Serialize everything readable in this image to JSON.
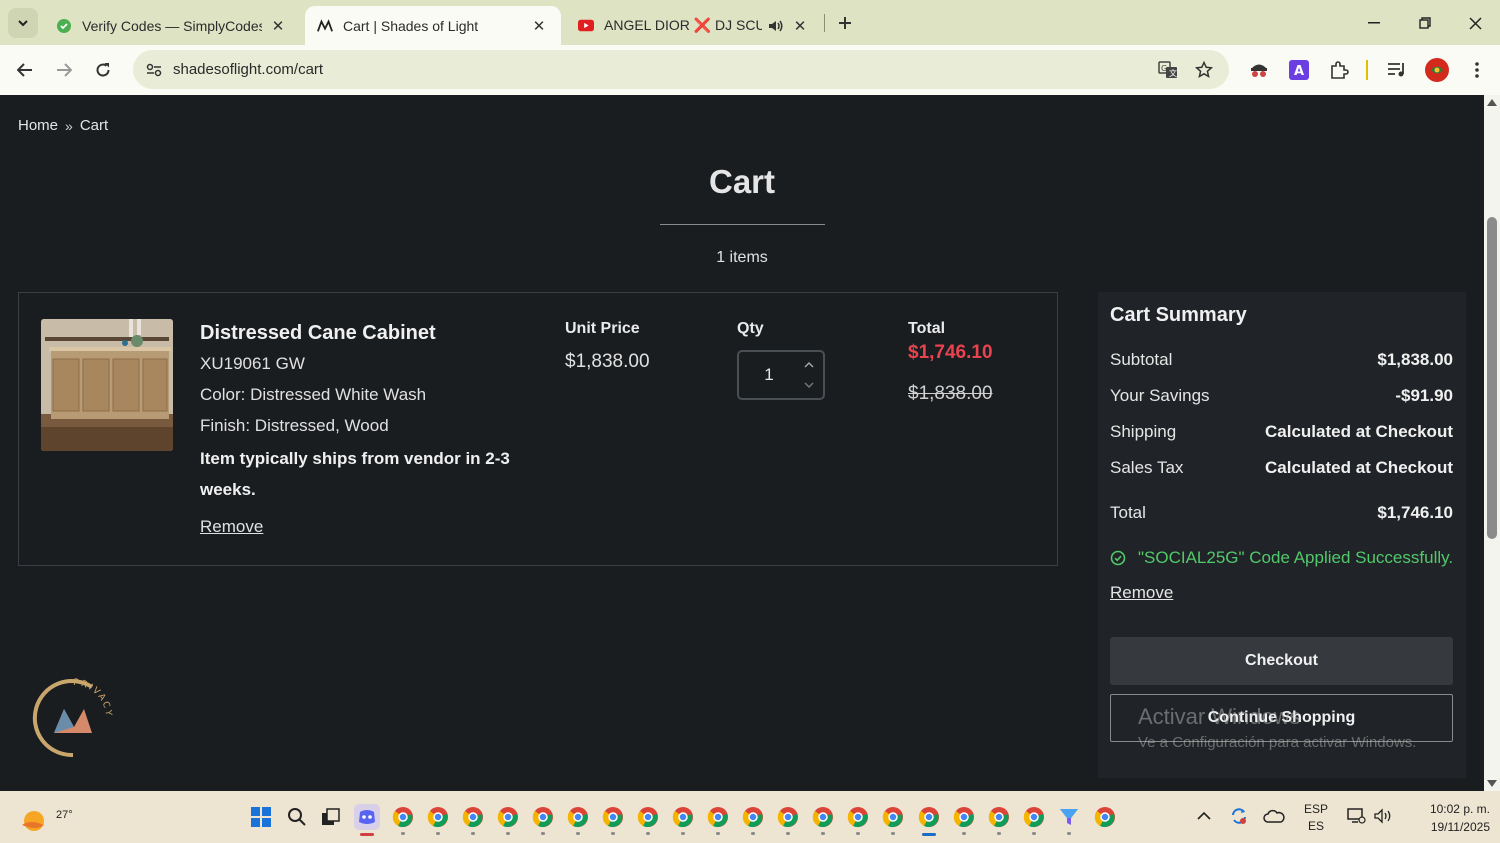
{
  "browser": {
    "tabs": [
      {
        "title": "Verify Codes — SimplyCodes",
        "close": "✕"
      },
      {
        "title": "Cart | Shades of Light",
        "close": "✕"
      },
      {
        "title": "ANGEL DIOR ❌ DJ SCUFF",
        "close": "✕"
      }
    ],
    "url": "shadesoflight.com/cart"
  },
  "page": {
    "breadcrumb": {
      "home": "Home",
      "separator": "»",
      "current": "Cart"
    },
    "title": "Cart",
    "items_count": "1 items",
    "item": {
      "name": "Distressed Cane Cabinet",
      "sku": "XU19061 GW",
      "color": "Color: Distressed White Wash",
      "finish": "Finish: Distressed, Wood",
      "shipping_note": "Item typically ships from vendor in 2-3 weeks.",
      "remove": "Remove",
      "unit_price_label": "Unit Price",
      "unit_price": "$1,838.00",
      "qty_label": "Qty",
      "qty": "1",
      "total_label": "Total",
      "total_discounted": "$1,746.10",
      "total_original": "$1,838.00"
    },
    "summary": {
      "title": "Cart Summary",
      "rows": [
        {
          "label": "Subtotal",
          "value": "$1,838.00"
        },
        {
          "label": "Your Savings",
          "value": "-$91.90"
        },
        {
          "label": "Shipping",
          "value": "Calculated at Checkout"
        },
        {
          "label": "Sales Tax",
          "value": "Calculated at Checkout"
        },
        {
          "label": "Total",
          "value": "$1,746.10"
        }
      ],
      "coupon_message": "\"SOCIAL25G\" Code Applied Successfully.",
      "remove": "Remove",
      "checkout": "Checkout",
      "continue": "Continue Shopping"
    },
    "privacy_badge": "PRIVACY",
    "watermark": {
      "line1": "Activar Windows",
      "line2": "Ve a Configuración para activar Windows."
    }
  },
  "taskbar": {
    "weather_temp": "27°",
    "lang_top": "ESP",
    "lang_bottom": "ES",
    "time": "10:02 p. m.",
    "date": "19/11/2025"
  },
  "colors": {
    "page_bg": "#1a1d20",
    "accent_price": "#e8434e",
    "success": "#52c96a",
    "tabstrip": "#dee3c4"
  }
}
